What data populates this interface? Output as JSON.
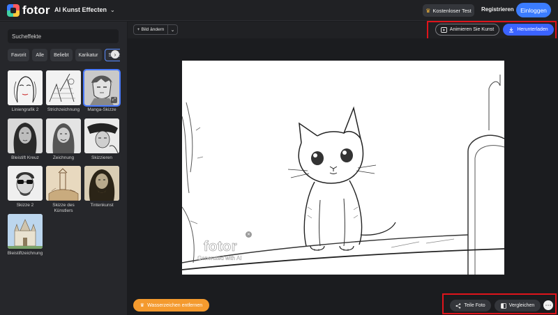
{
  "header": {
    "logo_text": "fotor",
    "app_menu": "AI Kunst Effecten",
    "trial_label": "Kostenloser Test",
    "register_label": "Registrieren",
    "login_label": "Einloggen"
  },
  "sidebar": {
    "search_placeholder": "Sucheffekte",
    "chips": [
      "Favorit",
      "Alle",
      "Beliebt",
      "Karikatur",
      "Skizze"
    ],
    "active_chip": "Skizze",
    "effects": [
      {
        "label": "Liniengrafik 2"
      },
      {
        "label": "Strichzeichnung"
      },
      {
        "label": "Manga-Skizze",
        "selected": true
      },
      {
        "label": "Bleistift Kreuz"
      },
      {
        "label": "Zeichnung"
      },
      {
        "label": "Skizzieren"
      },
      {
        "label": "Skizze 2"
      },
      {
        "label": "Skizze des Künstlers"
      },
      {
        "label": "Tintenkunst"
      },
      {
        "label": "Bleistiftzeichnung"
      }
    ]
  },
  "toolbar": {
    "change_image_label": "Bild ändern",
    "animate_label": "Animieren Sie Kunst",
    "download_label": "Herunterladen"
  },
  "canvas": {
    "watermark_logo": "fotor",
    "watermark_sub": "Generated with AI"
  },
  "footer": {
    "remove_watermark_label": "Wasserzeichen entfernen",
    "share_label": "Teile Foto",
    "compare_label": "Vergleichen"
  },
  "colors": {
    "accent": "#3b7cff",
    "download": "#3b63ff",
    "remove_watermark": "#f49a2e",
    "highlight": "#e0141b"
  }
}
